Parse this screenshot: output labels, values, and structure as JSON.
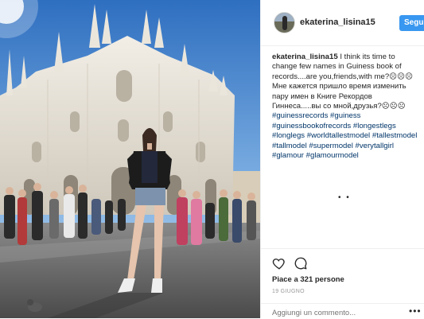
{
  "post": {
    "username": "ekaterina_lisina15",
    "follow_label": "Segui",
    "caption_user": "ekaterina_lisina15",
    "caption_line_1": "I think its time to change few names in Guiness book of records....are you,friends,with me?",
    "caption_emoji_1": "☹☹☹",
    "caption_line_2": "Мне кажется пришло время изменить пару имен в Книге Рекордов Гиннеса.....вы со мной,друзья?",
    "caption_emoji_2": "☹☹☹",
    "hashtags": "#guinessrecords #guiness #guinessbookofrecords #longestlegs #longlegs #worldtallestmodel #tallestmodel #tallmodel #supermodel #verytallgirl #glamour #glamourmodel",
    "dots": "• •",
    "likes": "Piace a 321 persone",
    "date": "19 GIUGNO",
    "comment_placeholder": "Aggiungi un commento...",
    "more": "•••"
  },
  "icons": {
    "like": "heart-icon",
    "comment": "comment-icon",
    "more": "more-options-icon"
  }
}
